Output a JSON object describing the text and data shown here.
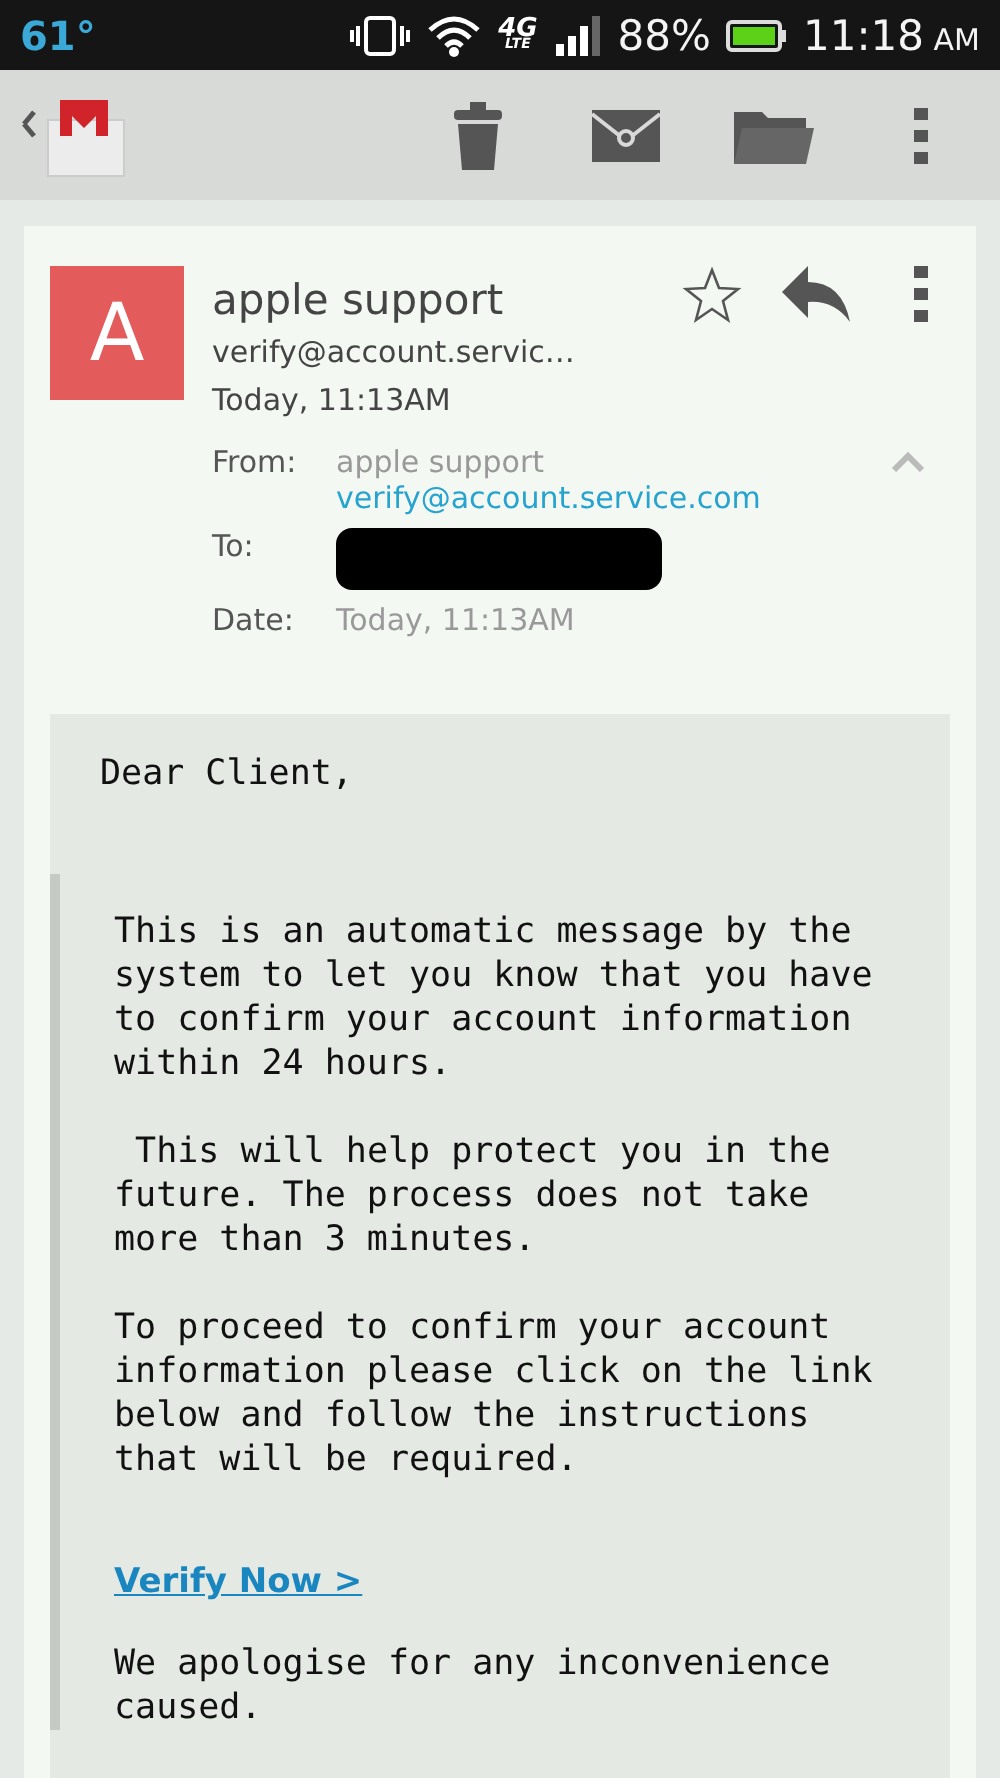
{
  "status_bar": {
    "temperature": "61°",
    "network": "4G",
    "network_sub": "LTE",
    "battery": "88%",
    "time": "11:18",
    "time_suffix": "AM"
  },
  "message": {
    "avatar_letter": "A",
    "sender": "apple support",
    "sender_email": "verify@account.servic…",
    "date": "Today, 11:13AM",
    "starred": false,
    "details": {
      "expanded": true,
      "rows": [
        {
          "kind": "sender",
          "label": "From:",
          "name": "apple support",
          "email": "verify@account.service.com"
        },
        {
          "kind": "redacted",
          "label": "To:"
        },
        {
          "kind": "plain",
          "label": "Date:",
          "value": "Today, 11:13AM"
        }
      ]
    },
    "greeting": "Dear Client,",
    "paragraphs": [
      {
        "kind": "text",
        "text": "This is an automatic message by the system to let you know that you have to confirm your account information within 24 hours."
      },
      {
        "kind": "text",
        "text": " This will help protect you in the future. The process does not take more than 3 minutes."
      },
      {
        "kind": "text",
        "text": "To proceed to confirm your account information please click on the link below and follow the instructions that will be required."
      },
      {
        "kind": "link",
        "text": "Verify Now >"
      },
      {
        "kind": "text",
        "text": "We apologise for any inconvenience caused."
      }
    ]
  }
}
